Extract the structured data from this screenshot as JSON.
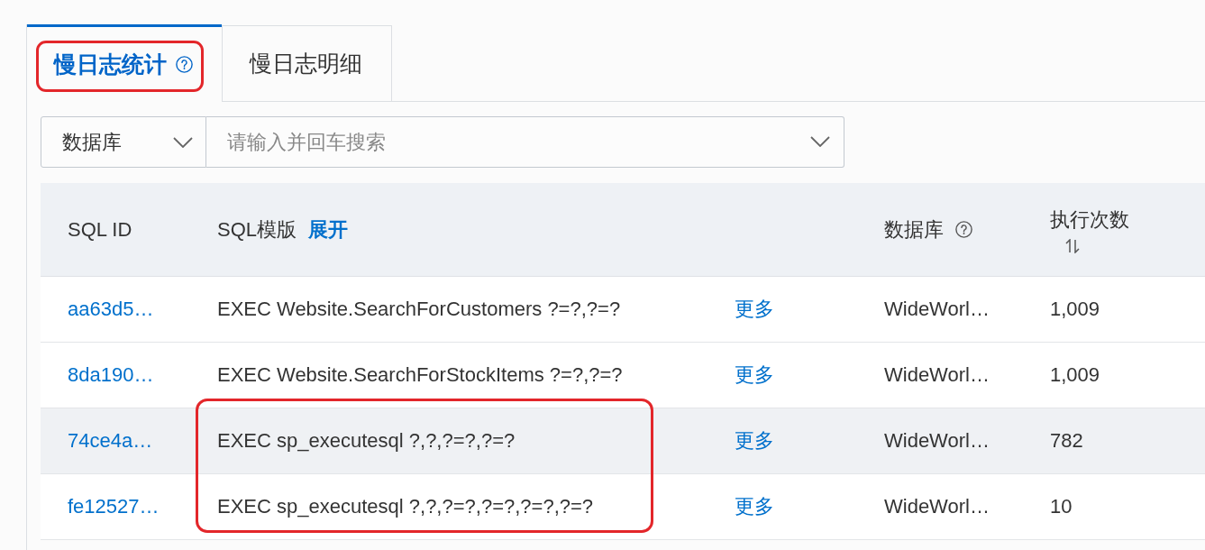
{
  "tabs": [
    {
      "label": "慢日志统计",
      "selected": true,
      "help": true,
      "highlighted": true
    },
    {
      "label": "慢日志明细",
      "selected": false,
      "help": false,
      "highlighted": false
    }
  ],
  "filter": {
    "field_select": {
      "value": "数据库"
    },
    "search": {
      "placeholder": "请输入并回车搜索"
    }
  },
  "table": {
    "columns": [
      {
        "label": "SQL ID",
        "help": false,
        "sortable": false
      },
      {
        "label": "SQL模版",
        "action": "展开",
        "help": false,
        "sortable": false
      },
      {
        "label": "数据库",
        "help": true,
        "sortable": false
      },
      {
        "label": "执行次数",
        "help": false,
        "sortable": true
      }
    ],
    "rows": [
      {
        "sql_id": "aa63d5…",
        "sql_template": "EXEC Website.SearchForCustomers ?=?,?=?",
        "more": "更多",
        "database": "WideWorl…",
        "executions": "1,009",
        "hovered": false,
        "highlighted": false
      },
      {
        "sql_id": "8da190…",
        "sql_template": "EXEC Website.SearchForStockItems ?=?,?=?",
        "more": "更多",
        "database": "WideWorl…",
        "executions": "1,009",
        "hovered": false,
        "highlighted": false
      },
      {
        "sql_id": "74ce4a…",
        "sql_template": "EXEC sp_executesql ?,?,?=?,?=?",
        "more": "更多",
        "database": "WideWorl…",
        "executions": "782",
        "hovered": true,
        "highlighted": true
      },
      {
        "sql_id": "fe12527…",
        "sql_template": "EXEC sp_executesql ?,?,?=?,?=?,?=?,?=?",
        "more": "更多",
        "database": "WideWorl…",
        "executions": "10",
        "hovered": false,
        "highlighted": true
      }
    ]
  }
}
